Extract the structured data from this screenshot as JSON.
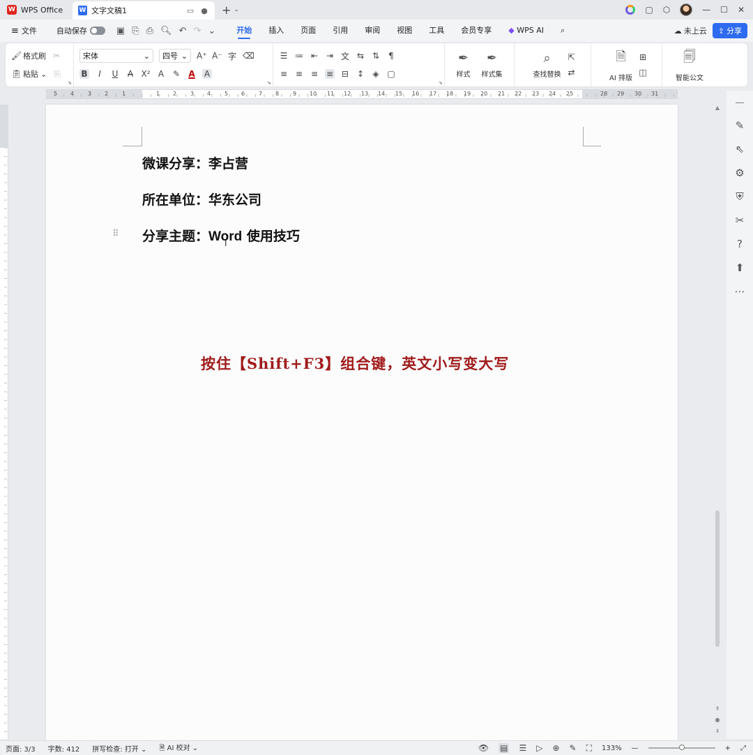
{
  "titlebar": {
    "app_tab": "WPS Office",
    "doc_tab": "文字文稿1"
  },
  "menubar": {
    "file": "文件",
    "autosave": "自动保存",
    "tabs": [
      "开始",
      "插入",
      "页面",
      "引用",
      "审阅",
      "视图",
      "工具",
      "会员专享"
    ],
    "wps_ai": "WPS AI",
    "cloud": "未上云",
    "share": "分享"
  },
  "ribbon": {
    "format_painter": "格式刷",
    "paste": "粘贴",
    "font_name": "宋体",
    "font_size": "四号",
    "styles": "样式",
    "style_set": "样式集",
    "find_replace": "查找替换",
    "ai_layout": "AI 排版",
    "smart_doc": "智能公文"
  },
  "ruler": {
    "numbers": [
      "5",
      "4",
      "3",
      "2",
      "1",
      "",
      "1",
      "2",
      "3",
      "4",
      "5",
      "6",
      "7",
      "8",
      "9",
      "10",
      "11",
      "12",
      "13",
      "14",
      "15",
      "16",
      "17",
      "18",
      "19",
      "20",
      "21",
      "22",
      "23",
      "24",
      "25",
      "",
      "28",
      "29",
      "30",
      "31"
    ]
  },
  "document": {
    "line1": "微课分享：李占营",
    "line2": "所在单位：华东公司",
    "line3_prefix": "分享主题：",
    "line3_en": "Word",
    "line3_suffix": " 使用技巧",
    "caption": "按住【Shift+F3】组合键，英文小写变大写"
  },
  "statusbar": {
    "page": "页面: 3/3",
    "words": "字数: 412",
    "spell": "拼写检查: 打开 ⌄",
    "ai_proof": "AI 校对 ⌄",
    "zoom": "133%"
  }
}
